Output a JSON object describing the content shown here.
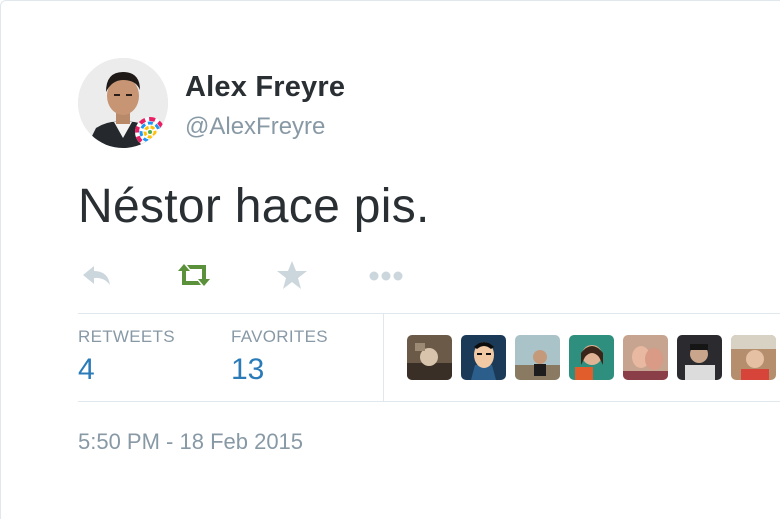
{
  "user": {
    "name": "Alex Freyre",
    "handle": "@AlexFreyre"
  },
  "tweet": {
    "text": "Néstor hace pis.",
    "timestamp": "5:50 PM - 18 Feb 2015"
  },
  "actions": [
    {
      "icon": "reply-icon"
    },
    {
      "icon": "retweet-icon",
      "color": "#5c913b"
    },
    {
      "icon": "favorite-icon"
    },
    {
      "icon": "more-icon"
    }
  ],
  "stats": {
    "retweets_label": "RETWEETS",
    "retweets_count": "4",
    "favorites_label": "FAVORITES",
    "favorites_count": "13"
  },
  "favoriters_count_shown": 7,
  "colors": {
    "text": "#292f33",
    "muted": "#8899a6",
    "link": "#2b7bb9",
    "retweet_green": "#5c913b",
    "border": "#e1e8ed"
  }
}
